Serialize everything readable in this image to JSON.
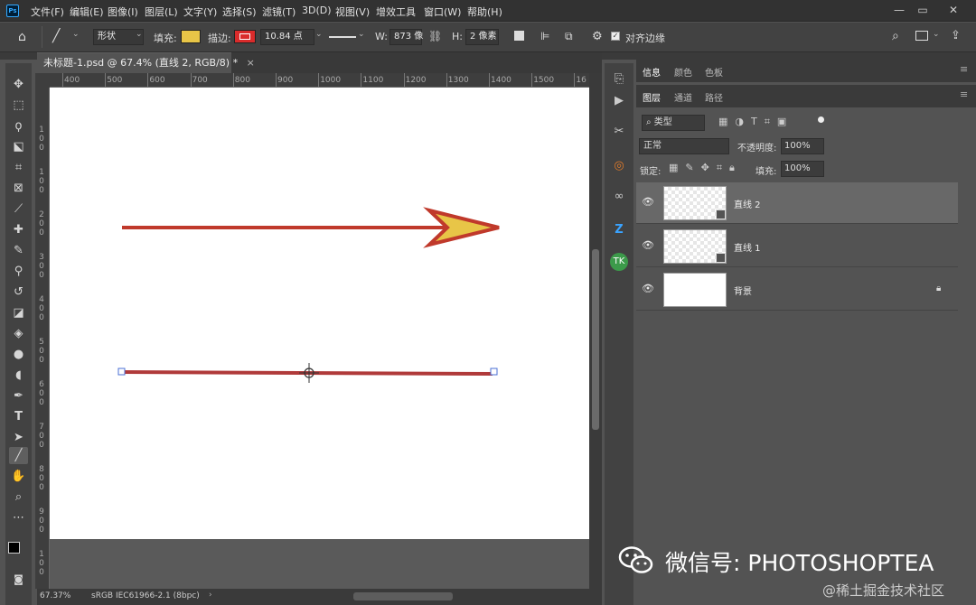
{
  "app": {
    "logo": "Ps"
  },
  "menu": [
    "文件(F)",
    "编辑(E)",
    "图像(I)",
    "图层(L)",
    "文字(Y)",
    "选择(S)",
    "滤镜(T)",
    "3D(D)",
    "视图(V)",
    "增效工具",
    "窗口(W)",
    "帮助(H)"
  ],
  "options": {
    "shape_mode": "形状",
    "fill_label": "填充:",
    "fill_color": "#e8c547",
    "stroke_label": "描边:",
    "stroke_color": "#d92b2b",
    "stroke_width": "10.84 点",
    "w_label": "W:",
    "w_value": "873 像",
    "h_label": "H:",
    "h_value": "2 像素",
    "align_edges": "对齐边缘"
  },
  "document": {
    "tab_title": "未标题-1.psd @ 67.4% (直线 2, RGB/8) *",
    "ruler_h": [
      "400",
      "500",
      "600",
      "700",
      "800",
      "900",
      "1000",
      "1100",
      "1200",
      "1300",
      "1400",
      "1500",
      "16"
    ],
    "ruler_v": [
      "1",
      "0",
      "0",
      "1",
      "0",
      "0",
      "2",
      "0",
      "0",
      "3",
      "0",
      "0",
      "4",
      "0",
      "0",
      "5",
      "0",
      "0",
      "6",
      "0",
      "0",
      "7",
      "0",
      "0",
      "8",
      "0",
      "0",
      "9",
      "0",
      "0",
      "1",
      "0",
      "0",
      "0"
    ],
    "zoom": "67.37%",
    "color_profile": "sRGB IEC61966-2.1 (8bpc)"
  },
  "panels": {
    "top_tabs": [
      "信息",
      "颜色",
      "色板"
    ],
    "layer_tabs": [
      "图层",
      "通道",
      "路径"
    ],
    "filter_label": "类型",
    "blend_mode": "正常",
    "opacity_label": "不透明度:",
    "opacity_value": "100%",
    "lock_label": "锁定:",
    "fill_label": "填充:",
    "fill_value": "100%",
    "layers": [
      {
        "name": "直线 2",
        "selected": true
      },
      {
        "name": "直线 1",
        "selected": false
      },
      {
        "name": "背景",
        "selected": false,
        "locked": true
      }
    ]
  },
  "watermark": {
    "main": "微信号: PHOTOSHOPTEA",
    "sub": "@稀土掘金技术社区"
  }
}
